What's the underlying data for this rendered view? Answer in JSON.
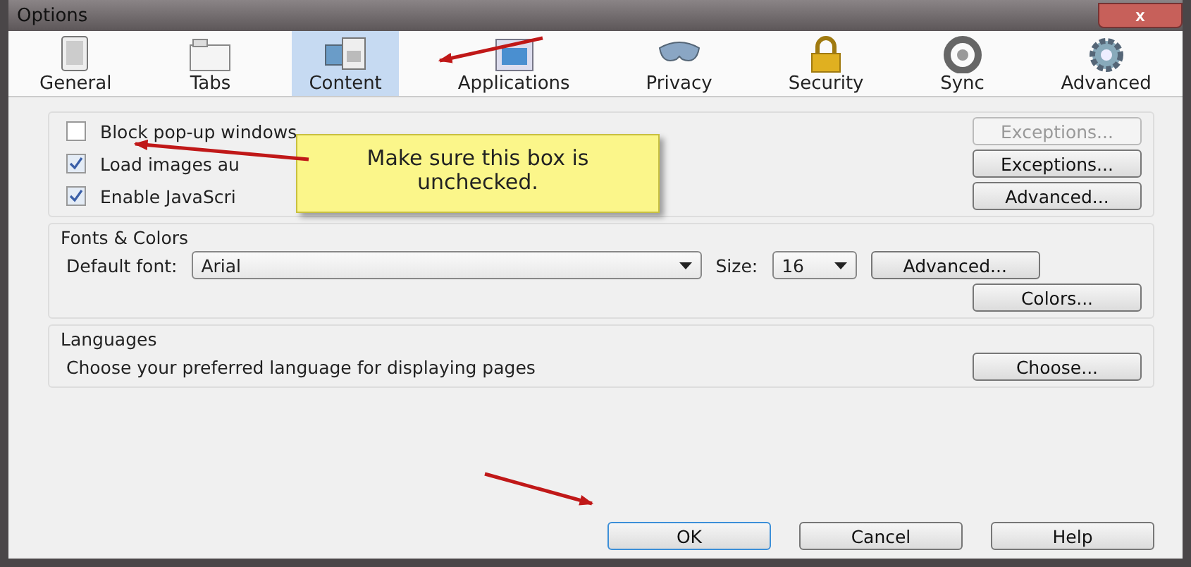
{
  "window": {
    "title": "Options",
    "close_label": "x"
  },
  "tabs": [
    {
      "label": "General",
      "kind": "general",
      "selected": false
    },
    {
      "label": "Tabs",
      "kind": "tabs",
      "selected": false
    },
    {
      "label": "Content",
      "kind": "content",
      "selected": true
    },
    {
      "label": "Applications",
      "kind": "applications",
      "selected": false
    },
    {
      "label": "Privacy",
      "kind": "privacy",
      "selected": false
    },
    {
      "label": "Security",
      "kind": "security",
      "selected": false
    },
    {
      "label": "Sync",
      "kind": "sync",
      "selected": false
    },
    {
      "label": "Advanced",
      "kind": "advanced",
      "selected": false
    }
  ],
  "content_group": {
    "options": [
      {
        "label": "Block pop-up windows",
        "checked": false,
        "button": {
          "label": "Exceptions...",
          "disabled": true
        }
      },
      {
        "label": "Load images au",
        "checked": true,
        "button": {
          "label": "Exceptions...",
          "disabled": false
        }
      },
      {
        "label": "Enable JavaScri",
        "checked": true,
        "button": {
          "label": "Advanced...",
          "disabled": false
        }
      }
    ]
  },
  "fonts_colors": {
    "title": "Fonts & Colors",
    "font_label": "Default font:",
    "font_value": "Arial",
    "font_open": false,
    "size_label": "Size:",
    "size_open": false,
    "size_value": "16",
    "buttons": [
      "Advanced...",
      "Colors..."
    ]
  },
  "languages": {
    "title": "Languages",
    "description": "Choose your preferred language for displaying pages",
    "button": "Choose..."
  },
  "callout": {
    "text": "Make sure this box is unchecked."
  },
  "buttons": [
    {
      "label": "OK",
      "default": true
    },
    {
      "label": "Cancel",
      "default": false
    },
    {
      "label": "Help",
      "default": false
    }
  ]
}
